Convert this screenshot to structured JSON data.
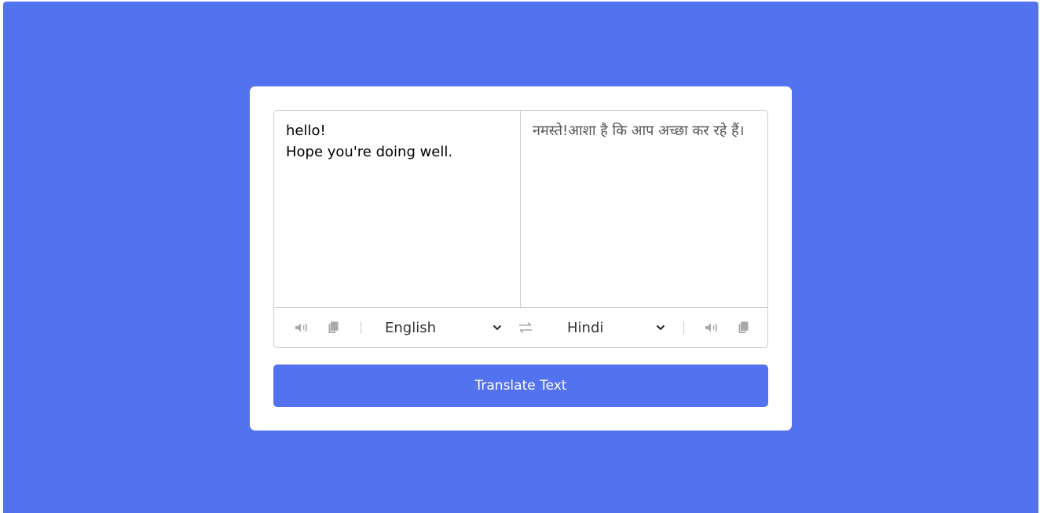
{
  "colors": {
    "background": "#5372f0",
    "card": "#ffffff",
    "button": "#5372f0",
    "icon": "#aaaaaa"
  },
  "translator": {
    "from_text": "hello!\nHope you're doing well.",
    "to_text": "नमस्ते!आशा है कि आप अच्छा कर रहे हैं।",
    "from_language": "English",
    "to_language": "Hindi",
    "translate_label": "Translate Text"
  },
  "icons": {
    "speak": "volume-icon",
    "copy": "copy-icon",
    "exchange": "exchange-icon",
    "dropdown": "chevron-down-icon"
  }
}
